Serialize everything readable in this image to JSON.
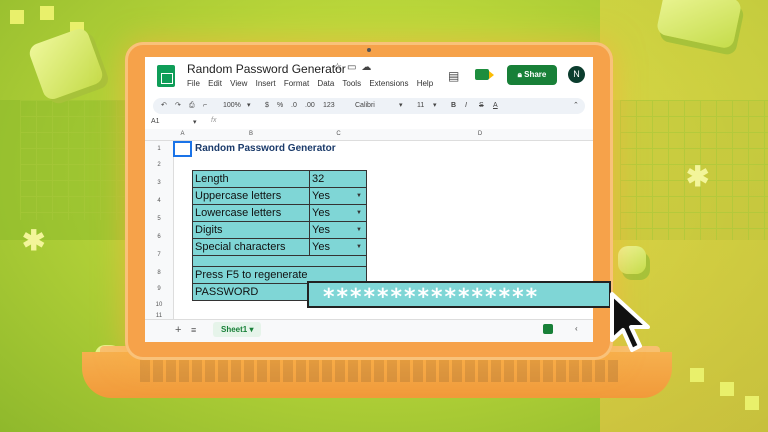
{
  "window": {
    "title": "Random Password Generator"
  },
  "menu": [
    "File",
    "Edit",
    "View",
    "Insert",
    "Format",
    "Data",
    "Tools",
    "Extensions",
    "Help"
  ],
  "header": {
    "share_label": "Share",
    "avatar_initial": "N"
  },
  "toolbar": {
    "zoom": "100%",
    "currency": "$",
    "percent": "%",
    "dec_less": ".0",
    "dec_more": ".00",
    "number_format": "123",
    "font": "Calibri",
    "font_size": "11"
  },
  "formula_bar": {
    "cell_ref": "A1",
    "fx": "fx"
  },
  "columns": [
    "A",
    "B",
    "C",
    "D"
  ],
  "rows": [
    "1",
    "2",
    "3",
    "4",
    "5",
    "6",
    "7",
    "8",
    "9",
    "10",
    "11"
  ],
  "sheet": {
    "heading": "Random Password Generator",
    "settings": [
      {
        "label": "Length",
        "value": "32"
      },
      {
        "label": "Uppercase letters",
        "value": "Yes"
      },
      {
        "label": "Lowercase letters",
        "value": "Yes"
      },
      {
        "label": "Digits",
        "value": "Yes"
      },
      {
        "label": "Special characters",
        "value": "Yes"
      }
    ],
    "regenerate_note": "Press F5 to regenerate",
    "password_label": "PASSWORD"
  },
  "tabs": {
    "sheet_name": "Sheet1"
  },
  "password_overlay": "****************",
  "colors": {
    "accent": "#188038",
    "teal_cell": "#7fd6d6",
    "laptop": "#f6a24a",
    "background": "#b9d63a"
  }
}
